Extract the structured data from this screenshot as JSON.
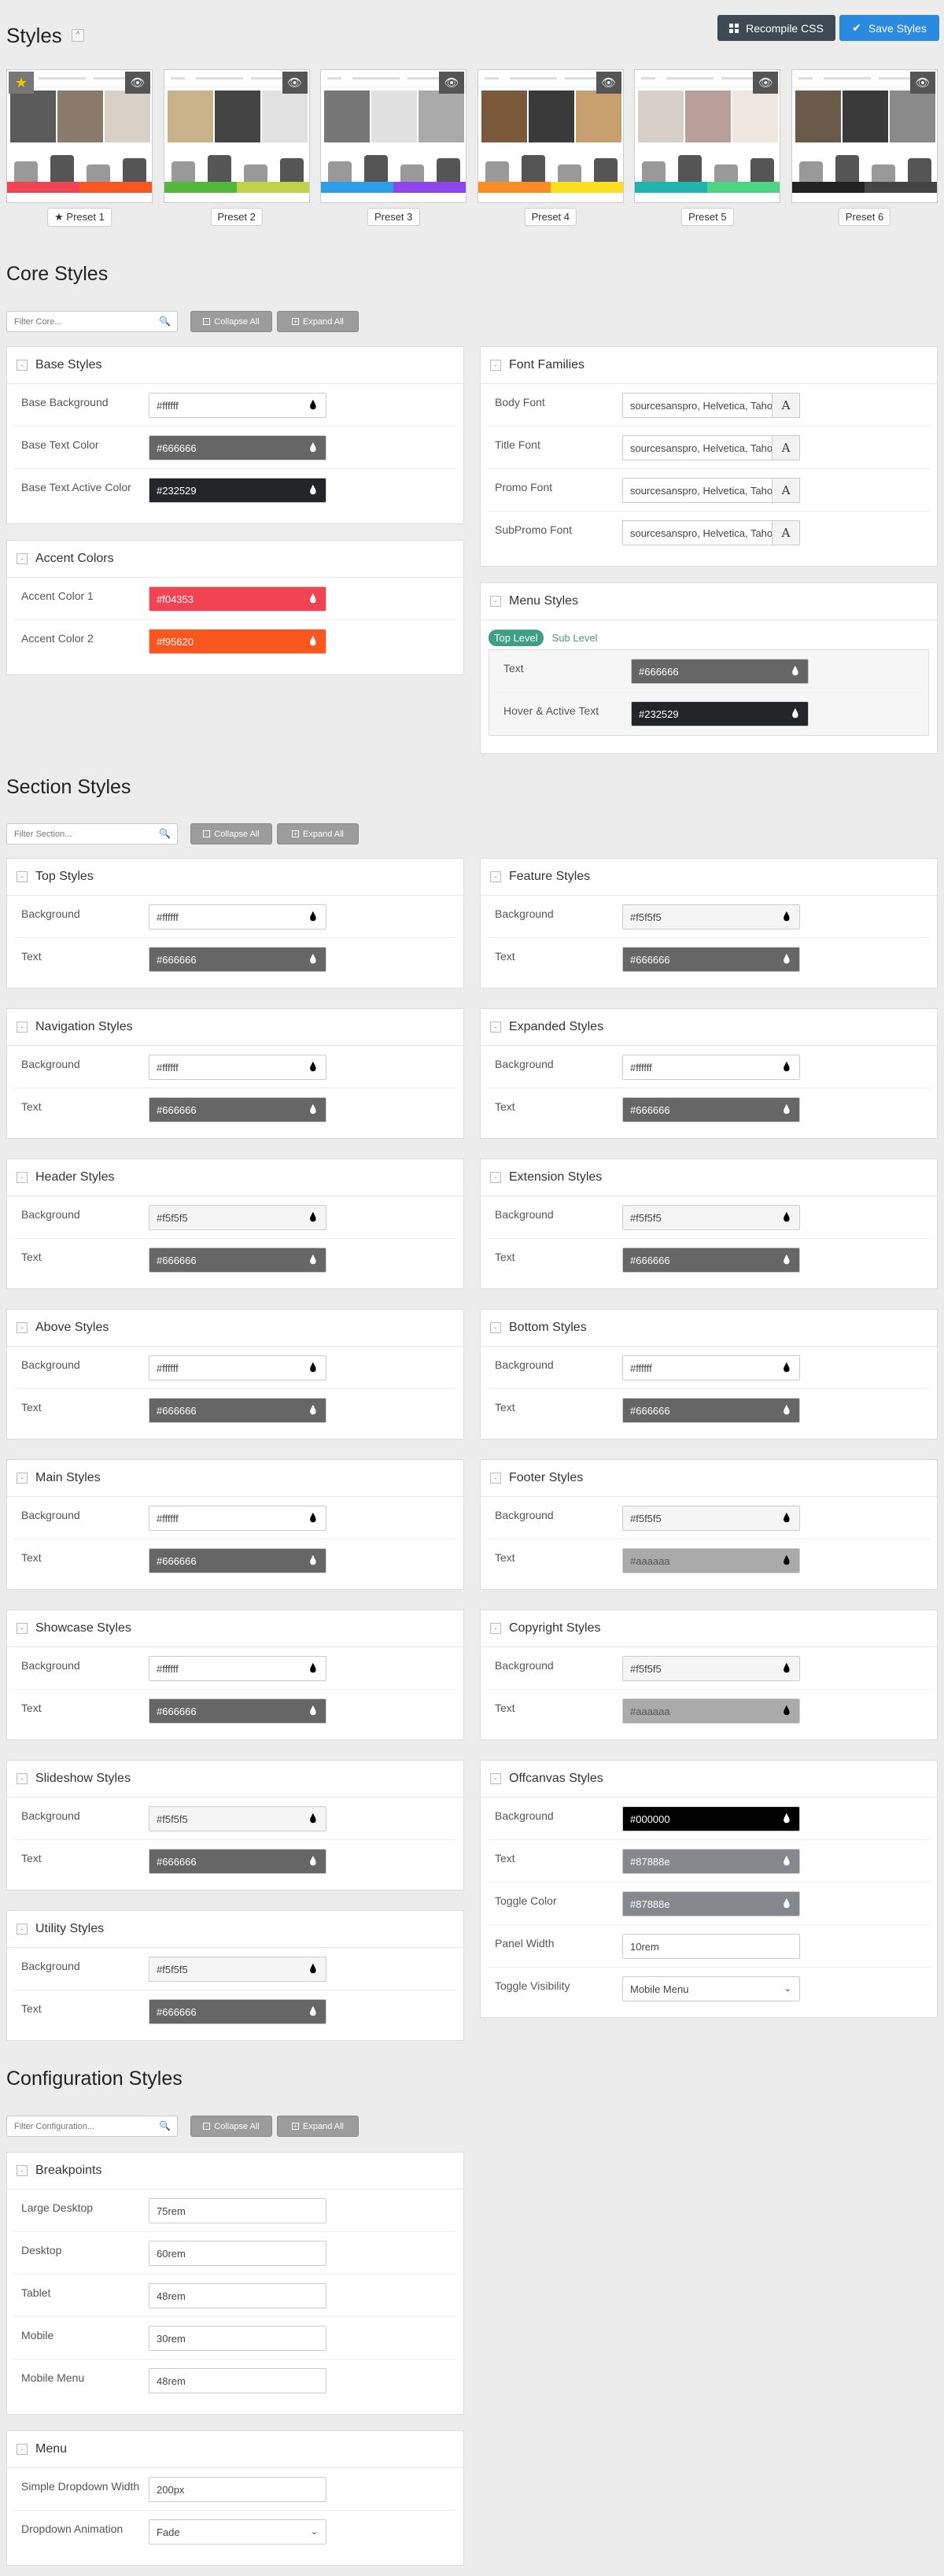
{
  "header": {
    "title": "Styles",
    "collapse_glyph": "^",
    "recompile": "Recompile CSS",
    "save": "Save Styles"
  },
  "presets": [
    {
      "label": "Preset 1",
      "active": true,
      "colors": [
        "#f04353",
        "#f95620"
      ]
    },
    {
      "label": "Preset 2",
      "active": false,
      "colors": [
        "#53b73b",
        "#c0d14a"
      ]
    },
    {
      "label": "Preset 3",
      "active": false,
      "colors": [
        "#2d9fe9",
        "#8e44ef"
      ]
    },
    {
      "label": "Preset 4",
      "active": false,
      "colors": [
        "#fb8c23",
        "#fbde1e"
      ]
    },
    {
      "label": "Preset 5",
      "active": false,
      "colors": [
        "#1fb4b0",
        "#4cd583"
      ]
    },
    {
      "label": "Preset 6",
      "active": false,
      "colors": [
        "#222222",
        "#444444"
      ]
    }
  ],
  "core": {
    "title": "Core Styles",
    "filter_placeholder": "Filter Core...",
    "collapse_all": "Collapse All",
    "expand_all": "Expand All",
    "base": {
      "title": "Base Styles",
      "rows": [
        {
          "label": "Base Background",
          "value": "#ffffff",
          "bg": "#ffffff",
          "fg": "#444444"
        },
        {
          "label": "Base Text Color",
          "value": "#666666",
          "bg": "#666666",
          "fg": "#ffffff"
        },
        {
          "label": "Base Text Active Color",
          "value": "#232529",
          "bg": "#232529",
          "fg": "#ffffff"
        }
      ]
    },
    "accent": {
      "title": "Accent Colors",
      "rows": [
        {
          "label": "Accent Color 1",
          "value": "#f04353",
          "bg": "#f04353",
          "fg": "#ffffff"
        },
        {
          "label": "Accent Color 2",
          "value": "#f95620",
          "bg": "#f95620",
          "fg": "#ffffff"
        }
      ]
    },
    "fonts": {
      "title": "Font Families",
      "rows": [
        {
          "label": "Body Font",
          "value": "sourcesanspro, Helvetica, Tahoma",
          "glyph": "A"
        },
        {
          "label": "Title Font",
          "value": "sourcesanspro, Helvetica, Tahoma",
          "glyph": "A"
        },
        {
          "label": "Promo Font",
          "value": "sourcesanspro, Helvetica, Tahoma",
          "glyph": "A"
        },
        {
          "label": "SubPromo Font",
          "value": "sourcesanspro, Helvetica, Tahoma",
          "glyph": "A"
        }
      ]
    },
    "menu": {
      "title": "Menu Styles",
      "tab_top": "Top Level",
      "tab_sub": "Sub Level",
      "rows": [
        {
          "label": "Text",
          "value": "#666666",
          "bg": "#666666",
          "fg": "#ffffff"
        },
        {
          "label": "Hover & Active Text",
          "value": "#232529",
          "bg": "#232529",
          "fg": "#ffffff"
        }
      ]
    }
  },
  "section": {
    "title": "Section Styles",
    "filter_placeholder": "Filter Section...",
    "collapse_all": "Collapse All",
    "expand_all": "Expand All",
    "left": [
      {
        "title": "Top Styles",
        "rows": [
          {
            "label": "Background",
            "value": "#ffffff",
            "bg": "#ffffff",
            "fg": "#444444"
          },
          {
            "label": "Text",
            "value": "#666666",
            "bg": "#666666",
            "fg": "#ffffff"
          }
        ]
      },
      {
        "title": "Navigation Styles",
        "rows": [
          {
            "label": "Background",
            "value": "#ffffff",
            "bg": "#ffffff",
            "fg": "#444444"
          },
          {
            "label": "Text",
            "value": "#666666",
            "bg": "#666666",
            "fg": "#ffffff"
          }
        ]
      },
      {
        "title": "Header Styles",
        "rows": [
          {
            "label": "Background",
            "value": "#f5f5f5",
            "bg": "#f5f5f5",
            "fg": "#444444"
          },
          {
            "label": "Text",
            "value": "#666666",
            "bg": "#666666",
            "fg": "#ffffff"
          }
        ]
      },
      {
        "title": "Above Styles",
        "rows": [
          {
            "label": "Background",
            "value": "#ffffff",
            "bg": "#ffffff",
            "fg": "#444444"
          },
          {
            "label": "Text",
            "value": "#666666",
            "bg": "#666666",
            "fg": "#ffffff"
          }
        ]
      },
      {
        "title": "Main Styles",
        "rows": [
          {
            "label": "Background",
            "value": "#ffffff",
            "bg": "#ffffff",
            "fg": "#444444"
          },
          {
            "label": "Text",
            "value": "#666666",
            "bg": "#666666",
            "fg": "#ffffff"
          }
        ]
      },
      {
        "title": "Showcase Styles",
        "rows": [
          {
            "label": "Background",
            "value": "#ffffff",
            "bg": "#ffffff",
            "fg": "#444444"
          },
          {
            "label": "Text",
            "value": "#666666",
            "bg": "#666666",
            "fg": "#ffffff"
          }
        ]
      },
      {
        "title": "Slideshow Styles",
        "rows": [
          {
            "label": "Background",
            "value": "#f5f5f5",
            "bg": "#f5f5f5",
            "fg": "#444444"
          },
          {
            "label": "Text",
            "value": "#666666",
            "bg": "#666666",
            "fg": "#ffffff"
          }
        ]
      },
      {
        "title": "Utility Styles",
        "rows": [
          {
            "label": "Background",
            "value": "#f5f5f5",
            "bg": "#f5f5f5",
            "fg": "#444444"
          },
          {
            "label": "Text",
            "value": "#666666",
            "bg": "#666666",
            "fg": "#ffffff"
          }
        ]
      }
    ],
    "right": [
      {
        "title": "Feature Styles",
        "rows": [
          {
            "label": "Background",
            "value": "#f5f5f5",
            "bg": "#f5f5f5",
            "fg": "#444444"
          },
          {
            "label": "Text",
            "value": "#666666",
            "bg": "#666666",
            "fg": "#ffffff"
          }
        ]
      },
      {
        "title": "Expanded Styles",
        "rows": [
          {
            "label": "Background",
            "value": "#ffffff",
            "bg": "#ffffff",
            "fg": "#444444"
          },
          {
            "label": "Text",
            "value": "#666666",
            "bg": "#666666",
            "fg": "#ffffff"
          }
        ]
      },
      {
        "title": "Extension Styles",
        "rows": [
          {
            "label": "Background",
            "value": "#f5f5f5",
            "bg": "#f5f5f5",
            "fg": "#444444"
          },
          {
            "label": "Text",
            "value": "#666666",
            "bg": "#666666",
            "fg": "#ffffff"
          }
        ]
      },
      {
        "title": "Bottom Styles",
        "rows": [
          {
            "label": "Background",
            "value": "#ffffff",
            "bg": "#ffffff",
            "fg": "#444444"
          },
          {
            "label": "Text",
            "value": "#666666",
            "bg": "#666666",
            "fg": "#ffffff"
          }
        ]
      },
      {
        "title": "Footer Styles",
        "rows": [
          {
            "label": "Background",
            "value": "#f5f5f5",
            "bg": "#f5f5f5",
            "fg": "#444444"
          },
          {
            "label": "Text",
            "value": "#aaaaaa",
            "bg": "#aaaaaa",
            "fg": "#555555"
          }
        ]
      },
      {
        "title": "Copyright Styles",
        "rows": [
          {
            "label": "Background",
            "value": "#f5f5f5",
            "bg": "#f5f5f5",
            "fg": "#444444"
          },
          {
            "label": "Text",
            "value": "#aaaaaa",
            "bg": "#aaaaaa",
            "fg": "#555555"
          }
        ]
      },
      {
        "title": "Offcanvas Styles",
        "rows": [
          {
            "label": "Background",
            "value": "#000000",
            "bg": "#000000",
            "fg": "#ffffff"
          },
          {
            "label": "Text",
            "value": "#87888e",
            "bg": "#87888e",
            "fg": "#ffffff"
          },
          {
            "label": "Toggle Color",
            "value": "#87888e",
            "bg": "#87888e",
            "fg": "#ffffff"
          },
          {
            "label": "Panel Width",
            "value": "10rem",
            "kind": "text"
          },
          {
            "label": "Toggle Visibility",
            "value": "Mobile Menu",
            "kind": "select"
          }
        ]
      }
    ]
  },
  "config": {
    "title": "Configuration Styles",
    "filter_placeholder": "Filter Configuration...",
    "collapse_all": "Collapse All",
    "expand_all": "Expand All",
    "breakpoints": {
      "title": "Breakpoints",
      "rows": [
        {
          "label": "Large Desktop",
          "value": "75rem"
        },
        {
          "label": "Desktop",
          "value": "60rem"
        },
        {
          "label": "Tablet",
          "value": "48rem"
        },
        {
          "label": "Mobile",
          "value": "30rem"
        },
        {
          "label": "Mobile Menu",
          "value": "48rem"
        }
      ]
    },
    "menu": {
      "title": "Menu",
      "rows": [
        {
          "label": "Simple Dropdown Width",
          "value": "200px",
          "kind": "text"
        },
        {
          "label": "Dropdown Animation",
          "value": "Fade",
          "kind": "select"
        }
      ]
    }
  },
  "colors": {
    "dark_btn": "#3d4a53",
    "blue_btn": "#2a8ae0",
    "accent": "#3f9f85"
  }
}
